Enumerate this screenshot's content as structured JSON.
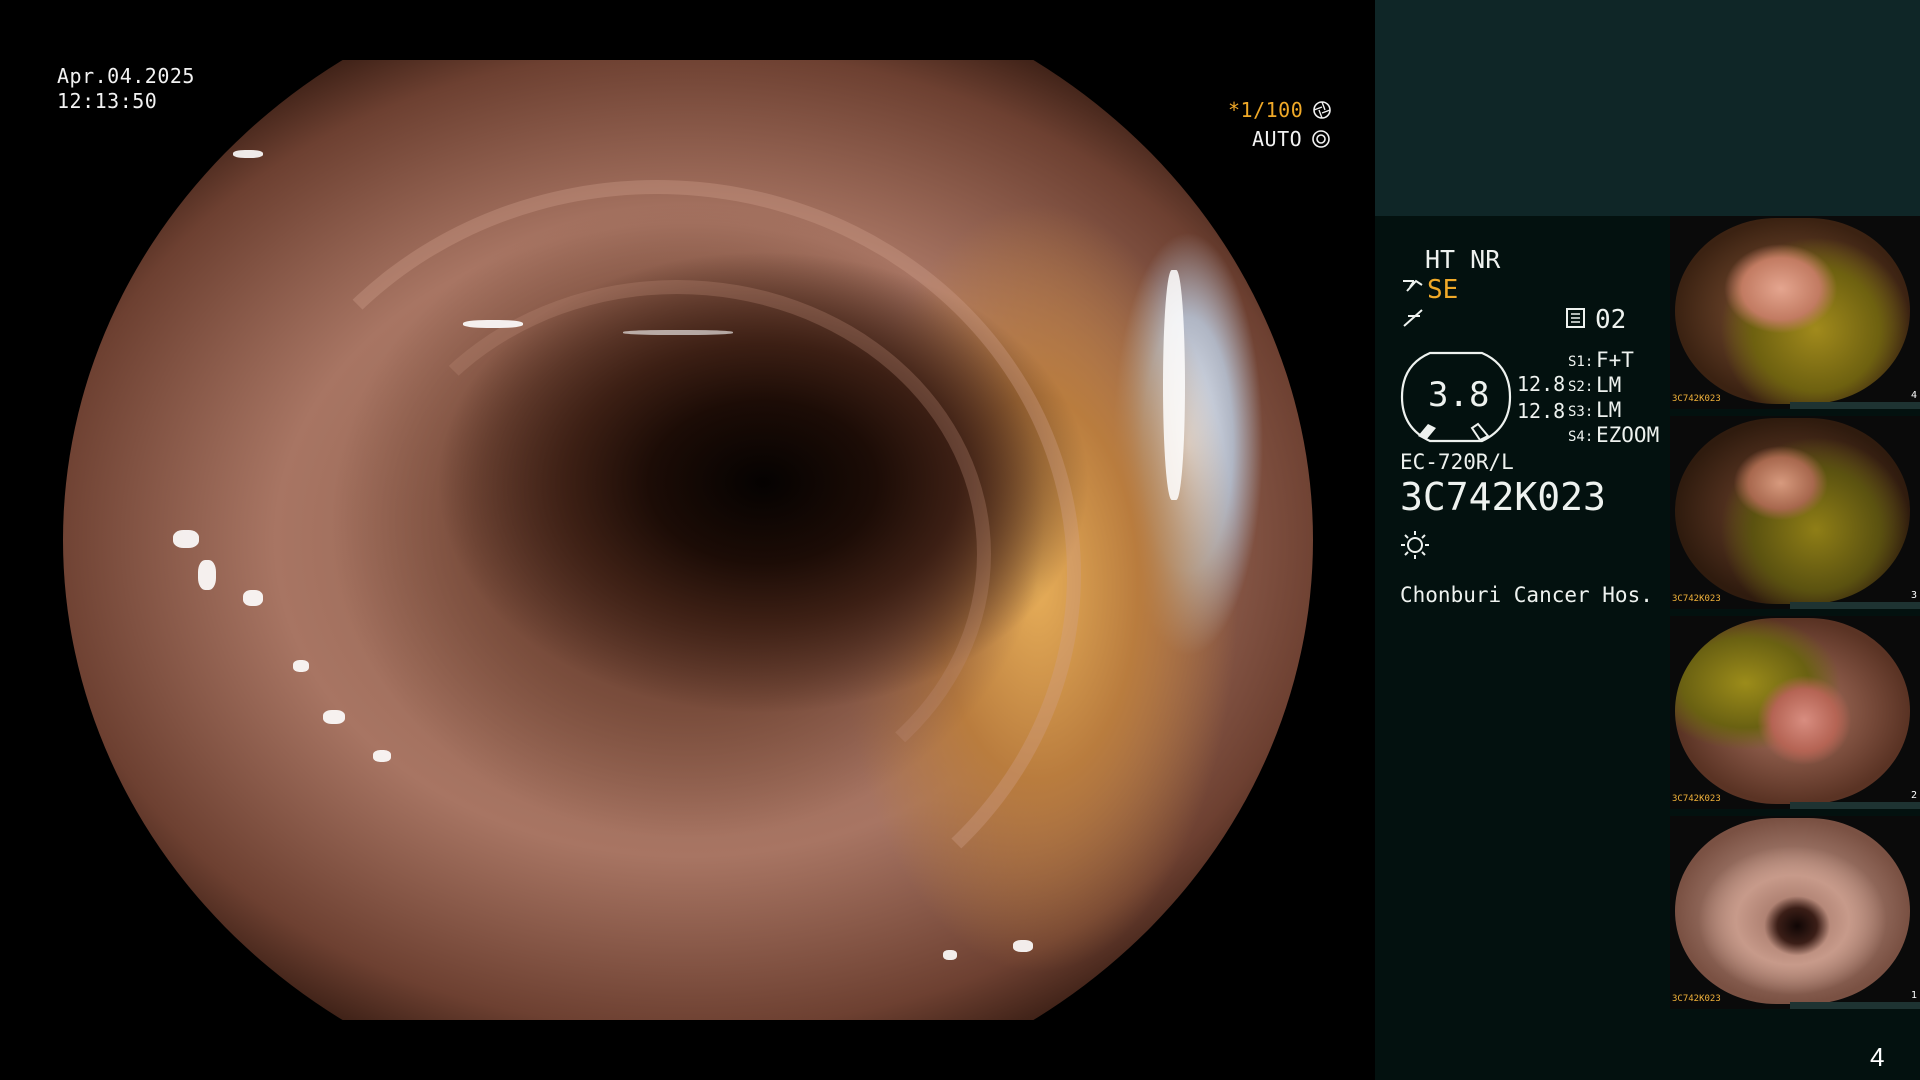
{
  "overlay": {
    "date": "Apr.04.2025",
    "time": "12:13:50",
    "shutter": "*1/100",
    "iris_mode": "AUTO"
  },
  "panel": {
    "ht_nr": "HT NR",
    "se": "SE",
    "memory": "02",
    "gauge_value": "3.8",
    "right_value_1": "12.8",
    "right_value_2": "12.8",
    "switches": [
      {
        "label": "S1:",
        "value": "F+T"
      },
      {
        "label": "S2:",
        "value": "LM"
      },
      {
        "label": "S3:",
        "value": "LM"
      },
      {
        "label": "S4:",
        "value": "EZOOM"
      }
    ],
    "scope_model": "EC-720R/L",
    "scope_serial": "3C742K023",
    "hospital": "Chonburi Cancer Hos."
  },
  "thumbnails": [
    {
      "num": "4",
      "serial": "3C742K023"
    },
    {
      "num": "3",
      "serial": "3C742K023"
    },
    {
      "num": "2",
      "serial": "3C742K023"
    },
    {
      "num": "1",
      "serial": "3C742K023"
    }
  ],
  "page_number": "4",
  "colors": {
    "accent": "#f0a928",
    "panel_top": "#0f2627",
    "panel": "#03110f"
  },
  "icons": [
    "shutter-icon",
    "auto-iris-icon",
    "se-mode-icon",
    "freeze-icon",
    "memory-icon",
    "light-icon"
  ]
}
